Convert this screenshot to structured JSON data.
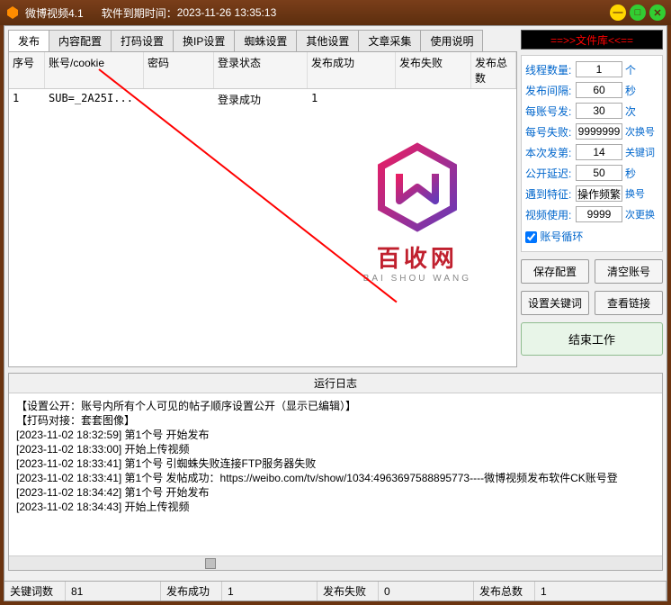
{
  "titlebar": {
    "app_name": "微博视频4.1",
    "expiry_label": "软件到期时间：",
    "expiry_value": "2023-11-26 13:35:13"
  },
  "tabs": [
    "发布",
    "内容配置",
    "打码设置",
    "换IP设置",
    "蜘蛛设置",
    "其他设置",
    "文章采集",
    "使用说明"
  ],
  "table": {
    "headers": [
      "序号",
      "账号/cookie",
      "密码",
      "登录状态",
      "发布成功",
      "发布失败",
      "发布总数"
    ],
    "rows": [
      {
        "seq": "1",
        "account": "SUB=_2A25I...",
        "pwd": "",
        "login": "登录成功",
        "succ": "1",
        "fail": "",
        "total": ""
      }
    ]
  },
  "logo": {
    "cn": "百收网",
    "en": "BAI SHOU WANG"
  },
  "file_library_btn": "==>>文件库<<==",
  "settings": {
    "threads": {
      "label": "线程数量:",
      "value": "1",
      "unit": "个"
    },
    "interval": {
      "label": "发布间隔:",
      "value": "60",
      "unit": "秒"
    },
    "per_account": {
      "label": "每账号发:",
      "value": "30",
      "unit": "次"
    },
    "fail_limit": {
      "label": "每号失败:",
      "value": "9999999",
      "unit": "次换号"
    },
    "batch_no": {
      "label": "本次发第:",
      "value": "14",
      "unit": "关键词"
    },
    "public_delay": {
      "label": "公开延迟:",
      "value": "50",
      "unit": "秒"
    },
    "special": {
      "label": "遇到特征:",
      "value": "操作频繁",
      "unit": "换号"
    },
    "video_use": {
      "label": "视频使用:",
      "value": "9999",
      "unit": "次更换"
    },
    "loop": {
      "label": "账号循环",
      "checked": true
    }
  },
  "buttons": {
    "save_config": "保存配置",
    "clear_accounts": "清空账号",
    "set_keywords": "设置关键词",
    "view_links": "查看链接",
    "end_work": "结束工作"
  },
  "log": {
    "title": "运行日志",
    "lines": [
      "",
      "【设置公开：账号内所有个人可见的帖子顺序设置公开（显示已编辑）】",
      "",
      "【打码对接：套套图像】",
      "",
      "[2023-11-02 18:32:59] 第1个号 开始发布",
      "[2023-11-02 18:33:00] 开始上传视频",
      "[2023-11-02 18:33:41] 第1个号 引蜘蛛失败连接FTP服务器失败",
      "[2023-11-02 18:33:41] 第1个号 发帖成功：https://weibo.com/tv/show/1034:4963697588895773----微博视频发布软件CK账号登",
      "[2023-11-02 18:34:42] 第1个号 开始发布",
      "[2023-11-02 18:34:43] 开始上传视频"
    ]
  },
  "statusbar": {
    "keywords_label": "关键词数",
    "keywords_val": "81",
    "succ_label": "发布成功",
    "succ_val": "1",
    "fail_label": "发布失败",
    "fail_val": "0",
    "total_label": "发布总数",
    "total_val": "1"
  }
}
